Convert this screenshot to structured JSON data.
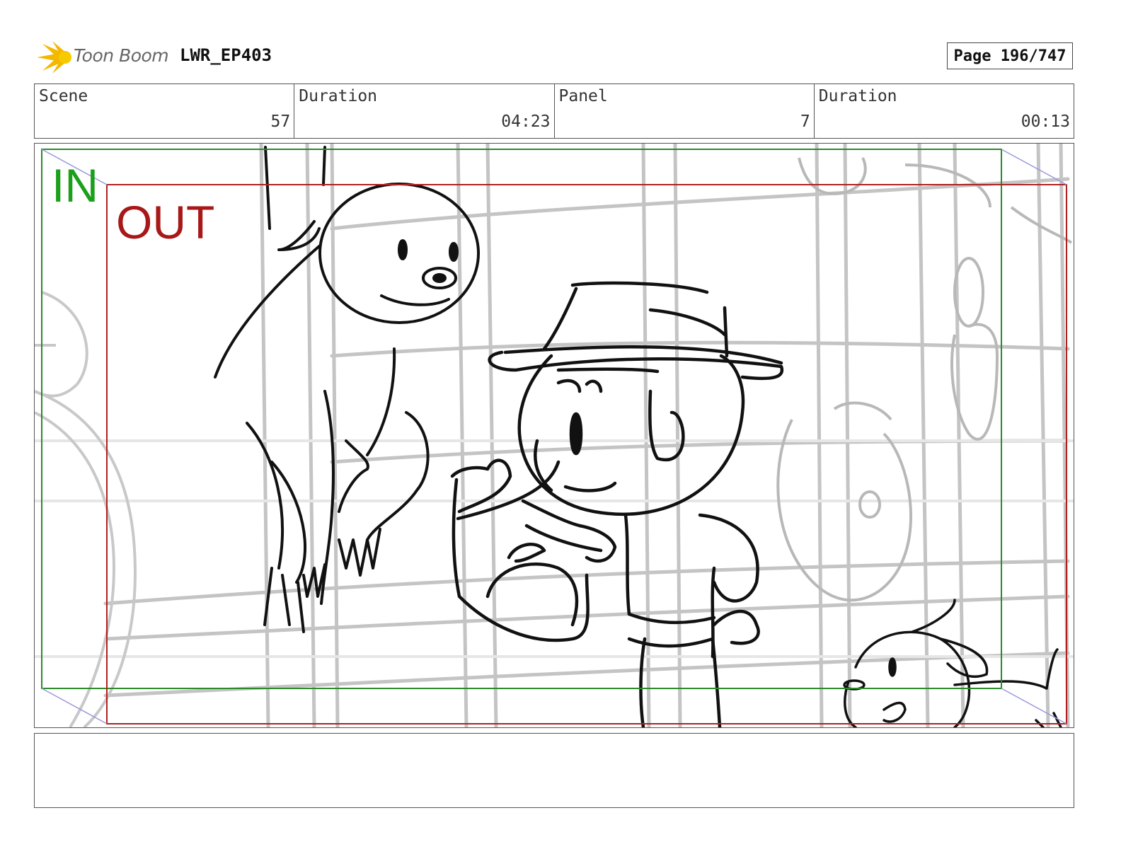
{
  "header": {
    "logo_text": "Toon Boom",
    "project": "LWR_EP403",
    "page": "Page 196/747"
  },
  "info": {
    "scene_label": "Scene",
    "scene_value": "57",
    "scene_duration_label": "Duration",
    "scene_duration_value": "04:23",
    "panel_label": "Panel",
    "panel_value": "7",
    "panel_duration_label": "Duration",
    "panel_duration_value": "00:13"
  },
  "frame": {
    "in_label": "IN",
    "out_label": "OUT",
    "in_color": "#1aa01a",
    "out_color": "#a81818"
  },
  "notes": {
    "text": ""
  }
}
